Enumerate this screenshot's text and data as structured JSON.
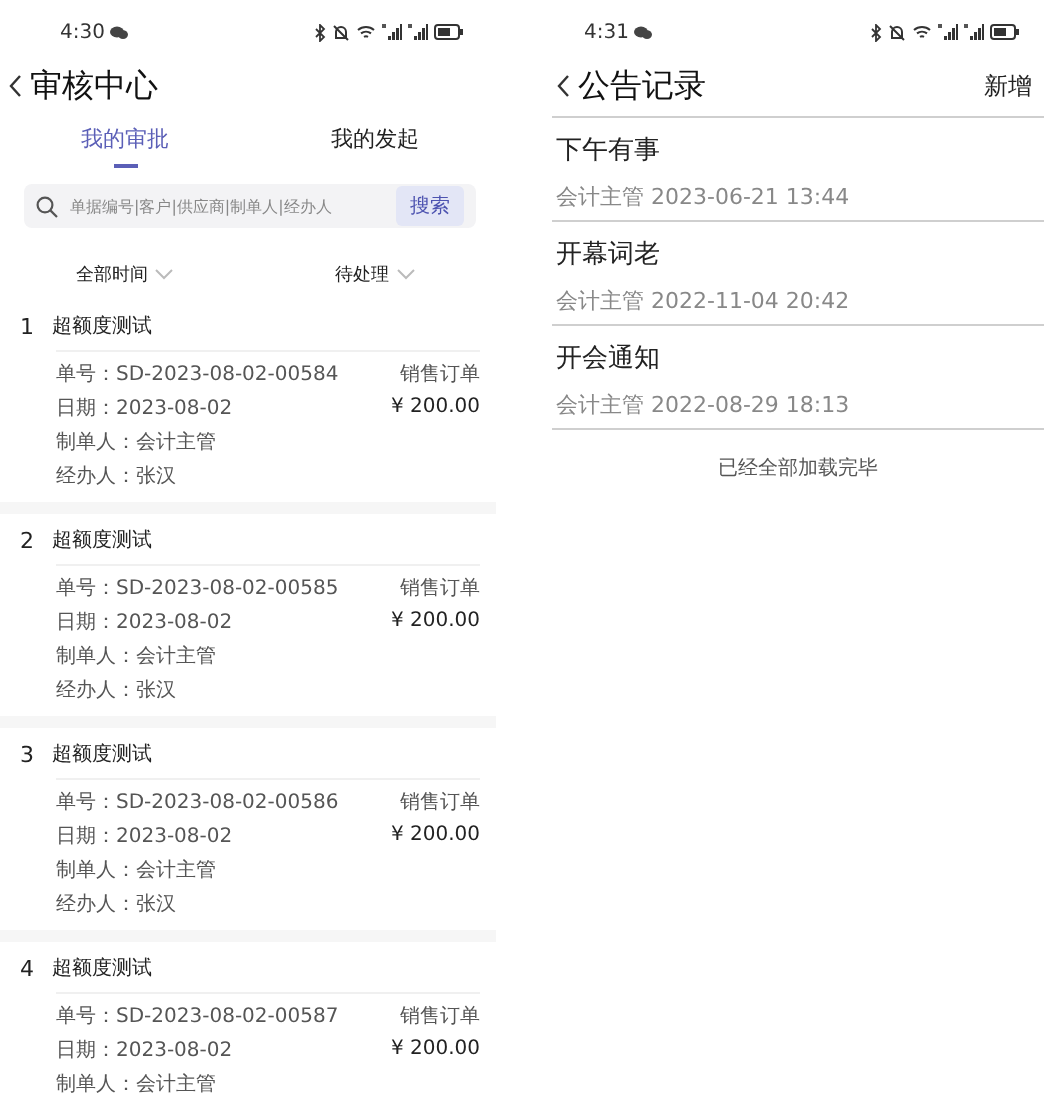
{
  "approval_screen": {
    "status_bar": {
      "time": "4:30"
    },
    "title": "审核中心",
    "tabs": [
      {
        "label": "我的审批",
        "selected": true
      },
      {
        "label": "我的发起",
        "selected": false
      }
    ],
    "search": {
      "placeholder": "单据编号|客户|供应商|制单人|经办人",
      "button": "搜索"
    },
    "filters": [
      {
        "label": "全部时间"
      },
      {
        "label": "待处理"
      }
    ],
    "records": [
      {
        "index": "1",
        "title": "超额度测试",
        "number": "单号：SD-2023-08-02-00584",
        "type": "销售订单",
        "date": "日期：2023-08-02",
        "amount": "¥ 200.00",
        "creator": "制单人：会计主管",
        "handler": "经办人：张汉"
      },
      {
        "index": "2",
        "title": "超额度测试",
        "number": "单号：SD-2023-08-02-00585",
        "type": "销售订单",
        "date": "日期：2023-08-02",
        "amount": "¥ 200.00",
        "creator": "制单人：会计主管",
        "handler": "经办人：张汉"
      },
      {
        "index": "3",
        "title": "超额度测试",
        "number": "单号：SD-2023-08-02-00586",
        "type": "销售订单",
        "date": "日期：2023-08-02",
        "amount": "¥ 200.00",
        "creator": "制单人：会计主管",
        "handler": "经办人：张汉"
      },
      {
        "index": "4",
        "title": "超额度测试",
        "number": "单号：SD-2023-08-02-00587",
        "type": "销售订单",
        "date": "日期：2023-08-02",
        "amount": "¥ 200.00",
        "creator": "制单人：会计主管"
      }
    ]
  },
  "notice_screen": {
    "status_bar": {
      "time": "4:31"
    },
    "title": "公告记录",
    "add_button": "新增",
    "notices": [
      {
        "title": "下午有事",
        "meta": "会计主管 2023-06-21 13:44"
      },
      {
        "title": "开幕词老",
        "meta": "会计主管 2022-11-04 20:42"
      },
      {
        "title": "开会通知",
        "meta": "会计主管 2022-08-29 18:13"
      }
    ],
    "footer": "已经全部加载完毕"
  }
}
